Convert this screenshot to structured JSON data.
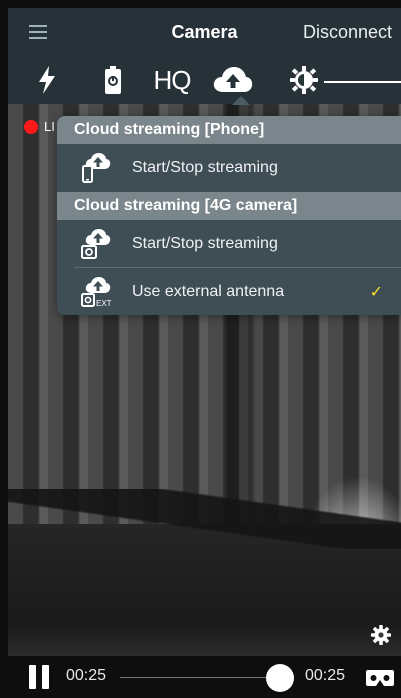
{
  "header": {
    "title": "Camera",
    "disconnect_label": "Disconnect"
  },
  "toolbar": {
    "items": [
      "flash-icon",
      "battery-icon",
      "hq-quality",
      "cloud-upload-icon",
      "brightness-icon"
    ],
    "hq_label": "HQ"
  },
  "live": {
    "label": "LI"
  },
  "dropdown": {
    "sections": [
      {
        "header": "Cloud streaming [Phone]",
        "items": [
          {
            "label": "Start/Stop streaming",
            "icon": "phone-cloud-upload-icon",
            "checked": false
          }
        ]
      },
      {
        "header": "Cloud streaming [4G camera]",
        "items": [
          {
            "label": "Start/Stop streaming",
            "icon": "camera-cloud-upload-icon",
            "checked": false
          },
          {
            "label": "Use external antenna",
            "icon": "camera-ext-cloud-upload-icon",
            "checked": true
          }
        ]
      }
    ],
    "check_mark": "✓",
    "ext_label": "EXT"
  },
  "player": {
    "current_time": "00:25",
    "total_time": "00:25"
  },
  "colors": {
    "bar": "#263238",
    "menu": "#3f4d55",
    "menu_header": "#7a868b",
    "live_dot": "#ff1a1a",
    "check": "#f5e12a"
  }
}
